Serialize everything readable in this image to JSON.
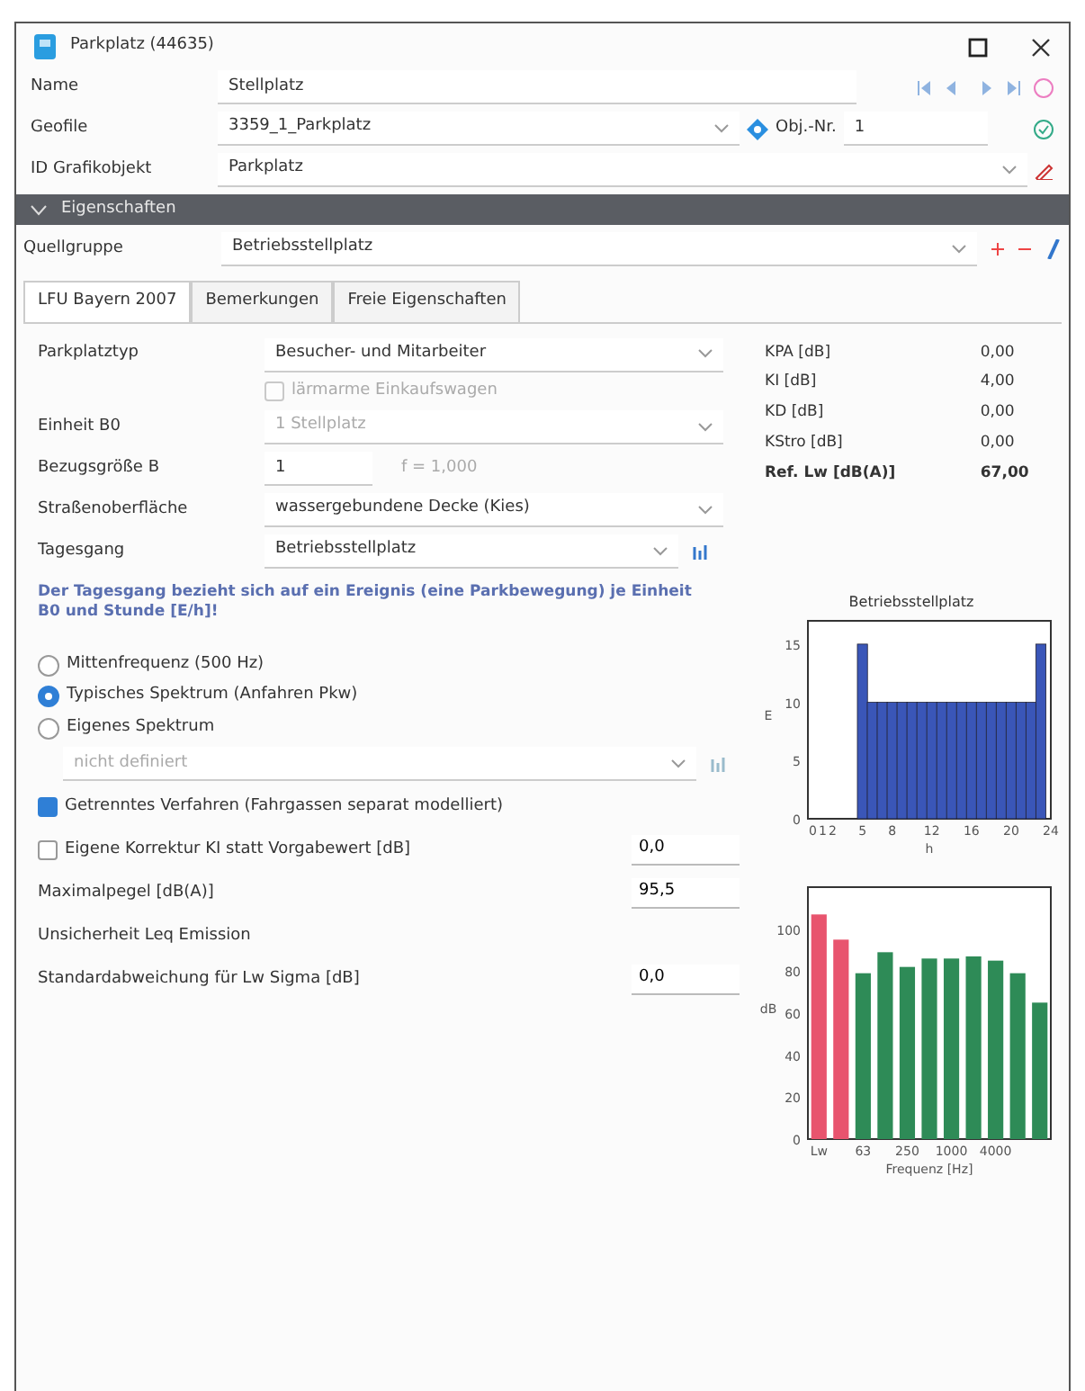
{
  "window": {
    "title": "Parkplatz (44635)"
  },
  "name_field": {
    "label": "Name",
    "value": "Stellplatz"
  },
  "geofile_field": {
    "label": "Geofile",
    "value": "3359_1_Parkplatz",
    "obj_label": "Obj.-Nr.",
    "obj_value": "1"
  },
  "graphic_field": {
    "label": "ID Grafikobjekt",
    "value": "Parkplatz"
  },
  "section": {
    "title": "Eigenschaften",
    "expanded": true
  },
  "source_group": {
    "label": "Quellgruppe",
    "value": "Betriebsstellplatz"
  },
  "tabs": [
    {
      "label": "LFU Bayern 2007",
      "selected": true
    },
    {
      "label": "Bemerkungen",
      "selected": false
    },
    {
      "label": "Freie Eigenschaften",
      "selected": false
    }
  ],
  "rows": [
    {
      "label": "Parkplatztyp",
      "value": "Besucher- und Mitarbeiter",
      "kind": "combo",
      "disabled": false
    },
    {
      "label": "lärmarme Einkaufswagen",
      "kind": "checkbox",
      "checked": false,
      "disabled": true
    },
    {
      "label": "Einheit B0",
      "value": "1 Stellplatz",
      "kind": "combo",
      "disabled": true
    },
    {
      "label": "Bezugsgröße B",
      "value": "1",
      "note": "f = 1,000",
      "kind": "number"
    },
    {
      "label": "Straßenoberfläche",
      "value": "wassergebundene Decke (Kies)",
      "kind": "combo",
      "disabled": false
    },
    {
      "label": "Tagesgang",
      "value": "Betriebsstellplatz",
      "kind": "combo-chart",
      "disabled": false
    }
  ],
  "info_text": "Der Tagesgang bezieht sich auf ein Ereignis (eine Parkbewegung) je Einheit B0 und Stunde [E/h]!",
  "radios": [
    {
      "label": "Mittenfrequenz (500 Hz)",
      "selected": false
    },
    {
      "label": "Typisches Spektrum (Anfahren Pkw)",
      "selected": true
    },
    {
      "label": "Eigenes Spektrum",
      "selected": false
    }
  ],
  "spectrum_combo": {
    "value": "nicht definiert",
    "disabled": true
  },
  "options": [
    {
      "label": "Getrenntes Verfahren (Fahrgassen separat modelliert)",
      "kind": "checkbox",
      "checked": true
    },
    {
      "label": "Eigene Korrektur KI statt Vorgabewert [dB]",
      "kind": "checkbox-value",
      "checked": false,
      "value": "0,0"
    },
    {
      "label": "Maximalpegel [dB(A)]",
      "kind": "value",
      "value": "95,5"
    },
    {
      "label": "Unsicherheit Leq Emission",
      "kind": "heading"
    },
    {
      "label": "Standardabweichung für Lw Sigma [dB]",
      "kind": "value",
      "value": "0,0"
    }
  ],
  "results": [
    {
      "label": "KPA [dB]",
      "value": "0,00",
      "bold": false
    },
    {
      "label": "KI [dB]",
      "value": "4,00",
      "bold": false
    },
    {
      "label": "KD [dB]",
      "value": "0,00",
      "bold": false
    },
    {
      "label": "KStro [dB]",
      "value": "0,00",
      "bold": false
    },
    {
      "label": "Ref. Lw [dB(A)]",
      "value": "67,00",
      "bold": true
    }
  ],
  "daily_chart": {
    "chart_data": {
      "type": "bar",
      "title": "Betriebsstellplatz",
      "ylabel": "E",
      "xlabel": "h",
      "x": [
        0,
        1,
        2,
        3,
        4,
        5,
        6,
        7,
        8,
        9,
        10,
        11,
        12,
        13,
        14,
        15,
        16,
        17,
        18,
        19,
        20,
        21,
        22,
        23
      ],
      "series": [
        {
          "color": "#3a56b8",
          "values": [
            0,
            0,
            0,
            0,
            0,
            15,
            10,
            10,
            10,
            10,
            10,
            10,
            10,
            10,
            10,
            10,
            10,
            10,
            10,
            10,
            10,
            10,
            10,
            15
          ]
        }
      ],
      "xticks": [
        0,
        1,
        2,
        5,
        8,
        12,
        16,
        20,
        24
      ],
      "yticks": [
        0,
        5,
        10,
        15
      ],
      "ylim": [
        0,
        17
      ],
      "xlim": [
        -0.5,
        24
      ]
    }
  },
  "spectrum_chart": {
    "chart_data": {
      "type": "bar",
      "xlabel": "Frequenz [Hz]",
      "ylabel": "dB",
      "categories": [
        "Lw",
        null,
        "63",
        null,
        "250",
        null,
        "1000",
        null,
        "4000",
        null,
        null
      ],
      "series": [
        {
          "color": "#e8546e",
          "values": [
            107,
            95,
            null,
            null,
            null,
            null,
            null,
            null,
            null,
            null,
            null
          ]
        },
        {
          "color": "#2e8b57",
          "values": [
            null,
            null,
            79,
            89,
            82,
            86,
            86,
            87,
            85,
            79,
            65
          ]
        }
      ],
      "yticks": [
        0,
        20,
        40,
        60,
        80,
        100
      ],
      "ylim": [
        0,
        120
      ]
    }
  }
}
